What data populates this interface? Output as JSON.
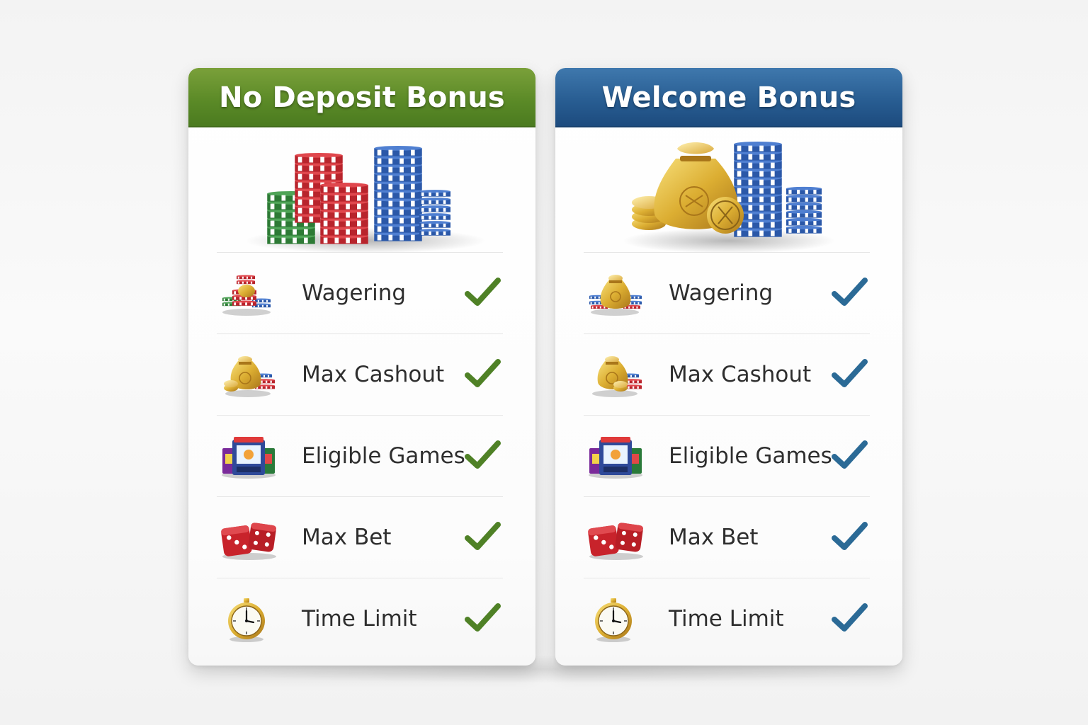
{
  "colors": {
    "green_accent": "#4f8126",
    "blue_accent": "#2b6a96",
    "text": "#2e2e2e"
  },
  "cards": [
    {
      "title": "No Deposit Bonus",
      "theme": "green",
      "hero_icon": "casino-chips-stack-icon",
      "features": [
        {
          "label": "Wagering",
          "icon": "chips-pile-icon",
          "checked": true
        },
        {
          "label": "Max Cashout",
          "icon": "money-bag-icon",
          "checked": true
        },
        {
          "label": "Eligible Games",
          "icon": "slot-machines-icon",
          "checked": true
        },
        {
          "label": "Max Bet",
          "icon": "dice-icon",
          "checked": true
        },
        {
          "label": "Time Limit",
          "icon": "stopwatch-icon",
          "checked": true
        }
      ]
    },
    {
      "title": "Welcome Bonus",
      "theme": "blue",
      "hero_icon": "gold-bag-and-chips-icon",
      "features": [
        {
          "label": "Wagering",
          "icon": "money-bag-chips-icon",
          "checked": true
        },
        {
          "label": "Max Cashout",
          "icon": "money-bag-icon",
          "checked": true
        },
        {
          "label": "Eligible Games",
          "icon": "slot-machines-icon",
          "checked": true
        },
        {
          "label": "Max Bet",
          "icon": "dice-icon",
          "checked": true
        },
        {
          "label": "Time Limit",
          "icon": "stopwatch-icon",
          "checked": true
        }
      ]
    }
  ]
}
